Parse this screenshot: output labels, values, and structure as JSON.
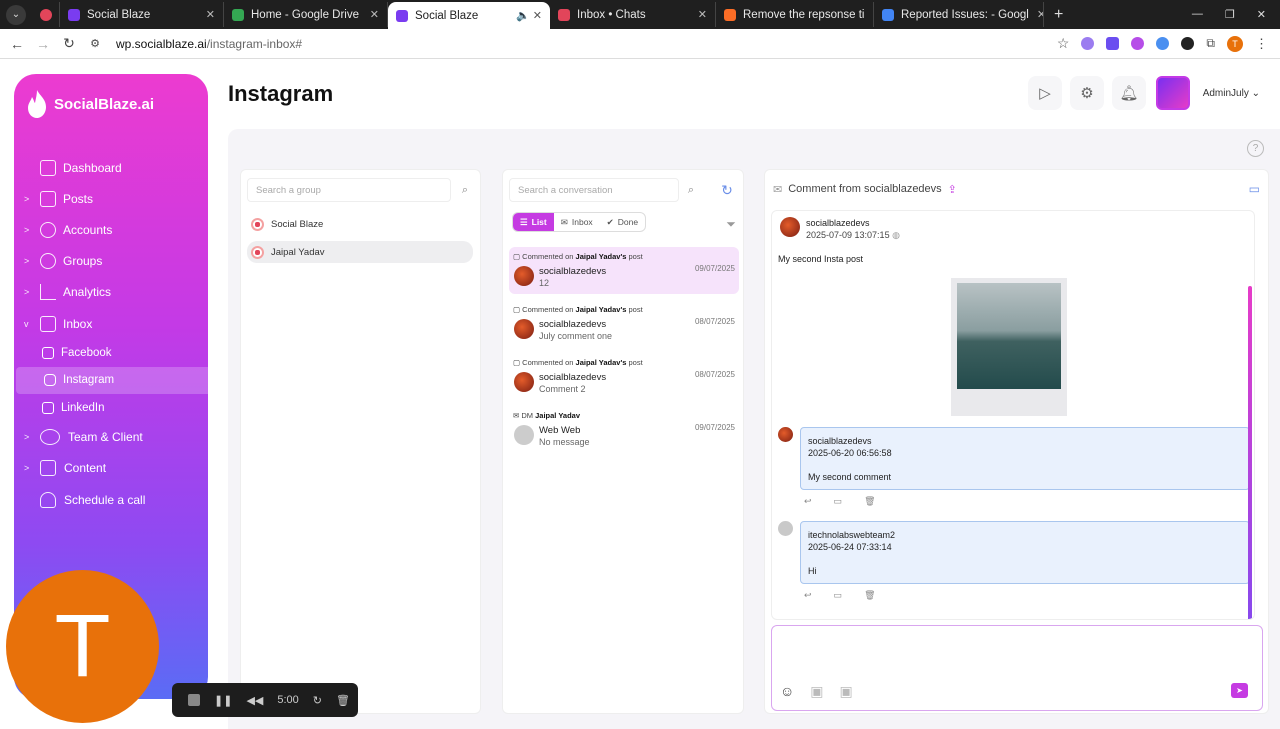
{
  "browser": {
    "tabs": [
      {
        "title": "Social Blaze",
        "fav": "#7a3cf0",
        "active": false
      },
      {
        "title": "Home - Google Drive",
        "fav": "#34a853",
        "active": false
      },
      {
        "title": "Social Blaze",
        "fav": "#7a3cf0",
        "active": true
      },
      {
        "title": "Inbox • Chats",
        "fav": "#e2455a",
        "active": false
      },
      {
        "title": "Remove the repsonse ti",
        "fav": "#fc6d26",
        "active": false
      },
      {
        "title": "Reported Issues: - Googl",
        "fav": "#4285f4",
        "active": false
      }
    ],
    "url_host": "wp.socialblaze.ai",
    "url_path": "/instagram-inbox#",
    "profile_initial": "T"
  },
  "sidebar": {
    "brand": "SocialBlaze.ai",
    "items": [
      {
        "label": "Dashboard",
        "chevron": "",
        "icon": "dashboard-icon"
      },
      {
        "label": "Posts",
        "chevron": ">",
        "icon": "posts-icon"
      },
      {
        "label": "Accounts",
        "chevron": ">",
        "icon": "accounts-icon"
      },
      {
        "label": "Groups",
        "chevron": ">",
        "icon": "groups-icon"
      },
      {
        "label": "Analytics",
        "chevron": ">",
        "icon": "analytics-icon"
      },
      {
        "label": "Inbox",
        "chevron": "v",
        "icon": "inbox-icon"
      }
    ],
    "subitems": [
      {
        "label": "Facebook",
        "icon": "facebook-icon"
      },
      {
        "label": "Instagram",
        "icon": "instagram-icon"
      },
      {
        "label": "LinkedIn",
        "icon": "linkedin-icon"
      }
    ],
    "items2": [
      {
        "label": "Team & Client",
        "chevron": ">",
        "icon": "team-icon"
      },
      {
        "label": "Content",
        "chevron": ">",
        "icon": "content-icon"
      },
      {
        "label": "Schedule a call",
        "chevron": "",
        "icon": "headset-icon"
      }
    ]
  },
  "header": {
    "title": "Instagram",
    "admin": "AdminJuly"
  },
  "groups": {
    "search_placeholder": "Search a group",
    "items": [
      "Social Blaze",
      "Jaipal Yadav"
    ]
  },
  "conversations": {
    "search_placeholder": "Search a conversation",
    "filters": [
      "List",
      "Inbox",
      "Done"
    ],
    "items": [
      {
        "prefix": "Commented on ",
        "owner": "Jaipal Yadav's",
        "suffix": " post",
        "name": "socialblazedevs",
        "msg": "12",
        "date": "09/07/2025"
      },
      {
        "prefix": "Commented on ",
        "owner": "Jaipal Yadav's",
        "suffix": " post",
        "name": "socialblazedevs",
        "msg": "July comment one",
        "date": "08/07/2025"
      },
      {
        "prefix": "Commented on ",
        "owner": "Jaipal Yadav's",
        "suffix": " post",
        "name": "socialblazedevs",
        "msg": "Comment 2",
        "date": "08/07/2025"
      },
      {
        "prefix": "DM ",
        "owner": "Jaipal Yadav",
        "suffix": "",
        "name": "Web Web",
        "msg": "No message",
        "date": "09/07/2025"
      }
    ]
  },
  "detail": {
    "header": "Comment from socialblazedevs",
    "post": {
      "author": "socialblazedevs",
      "date": "2025-07-09 13:07:15",
      "caption": "My second Insta post"
    },
    "comments": [
      {
        "name": "socialblazedevs",
        "date": "2025-06-20 06:56:58",
        "text": "My second comment"
      },
      {
        "name": "itechnolabswebteam2",
        "date": "2025-06-24 07:33:14",
        "text": "Hi"
      }
    ]
  },
  "recorder": {
    "time": "5:00",
    "avatar_initial": "T"
  }
}
